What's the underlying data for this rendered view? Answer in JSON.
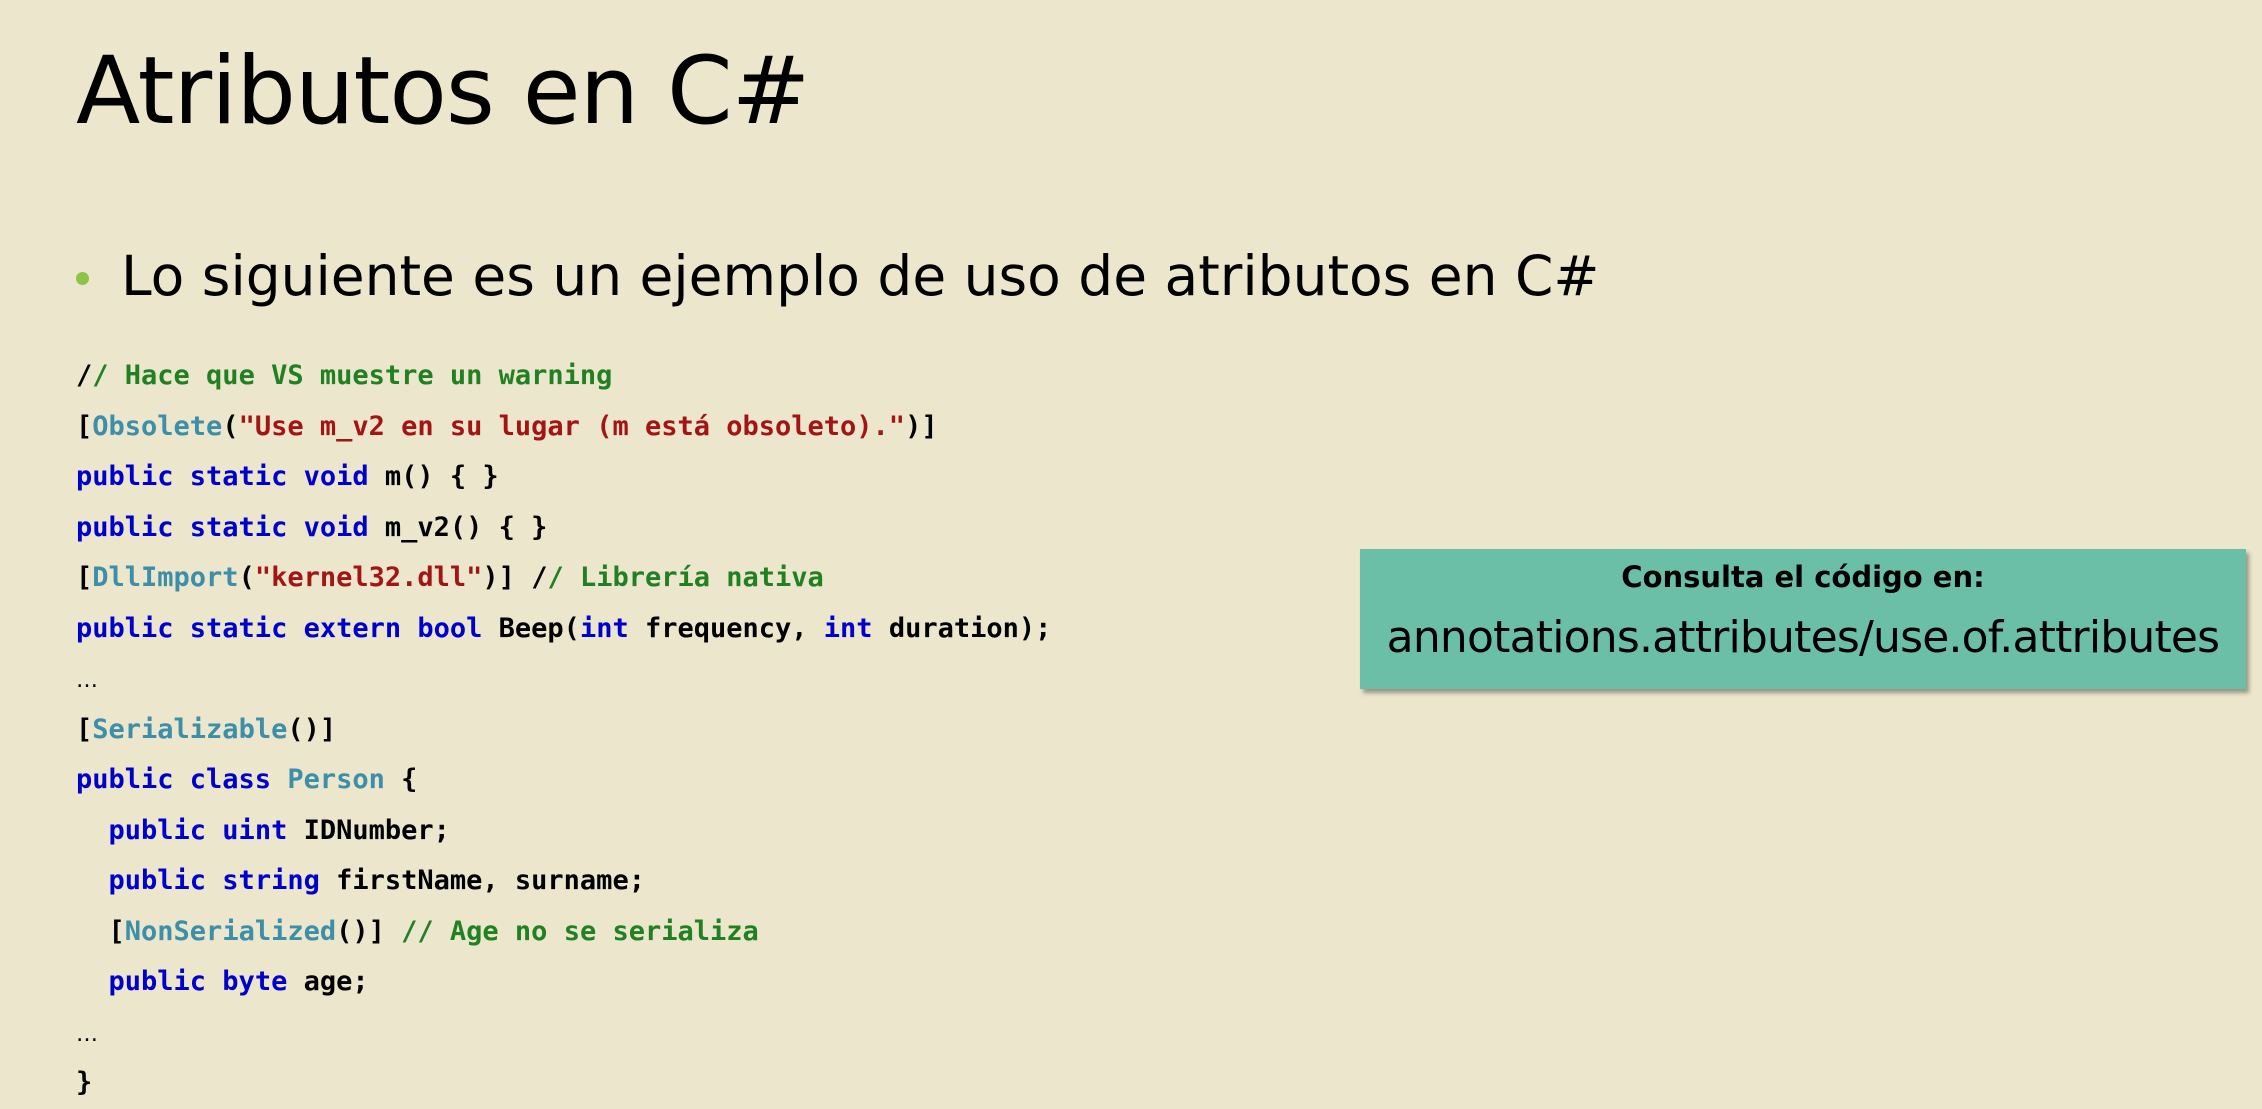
{
  "slide": {
    "title": "Atributos en C#",
    "bullet": "Lo siguiente es un ejemplo de uso de atributos en C#"
  },
  "code": {
    "lines": [
      [
        {
          "t": "/",
          "c": "pl"
        },
        {
          "t": "/ Hace que VS muestre un warning",
          "c": "cmt"
        }
      ],
      [
        {
          "t": "[",
          "c": "pl"
        },
        {
          "t": "Obsolete",
          "c": "typ"
        },
        {
          "t": "(",
          "c": "pl"
        },
        {
          "t": "\"Use m_v2 en su lugar (m está obsoleto).\"",
          "c": "str"
        },
        {
          "t": ")]",
          "c": "pl"
        }
      ],
      [
        {
          "t": "public static void",
          "c": "kw"
        },
        {
          "t": " m() { }",
          "c": "pl"
        }
      ],
      [
        {
          "t": "public static void",
          "c": "kw"
        },
        {
          "t": " m_v2() { }",
          "c": "pl"
        }
      ],
      [
        {
          "t": "[",
          "c": "pl"
        },
        {
          "t": "DllImport",
          "c": "typ"
        },
        {
          "t": "(",
          "c": "pl"
        },
        {
          "t": "\"kernel32.dll\"",
          "c": "str"
        },
        {
          "t": ")] /",
          "c": "pl"
        },
        {
          "t": "/ Librería nativa",
          "c": "cmt"
        }
      ],
      [
        {
          "t": "public static extern bool",
          "c": "kw"
        },
        {
          "t": " Beep(",
          "c": "pl"
        },
        {
          "t": "int",
          "c": "kw"
        },
        {
          "t": " frequency, ",
          "c": "pl"
        },
        {
          "t": "int",
          "c": "kw"
        },
        {
          "t": " duration);",
          "c": "pl"
        }
      ],
      [
        {
          "t": "…",
          "c": "pl dots"
        }
      ],
      [
        {
          "t": "[",
          "c": "pl"
        },
        {
          "t": "Serializable",
          "c": "typ"
        },
        {
          "t": "()]",
          "c": "pl"
        }
      ],
      [
        {
          "t": "public class",
          "c": "kw"
        },
        {
          "t": " ",
          "c": "pl"
        },
        {
          "t": "Person",
          "c": "typ"
        },
        {
          "t": " {",
          "c": "pl"
        }
      ],
      [
        {
          "t": "  ",
          "c": "pl"
        },
        {
          "t": "public uint",
          "c": "kw"
        },
        {
          "t": " IDNumber;",
          "c": "pl"
        }
      ],
      [
        {
          "t": "  ",
          "c": "pl"
        },
        {
          "t": "public string",
          "c": "kw"
        },
        {
          "t": " firstName, surname;",
          "c": "pl"
        }
      ],
      [
        {
          "t": "  [",
          "c": "pl"
        },
        {
          "t": "NonSerialized",
          "c": "typ"
        },
        {
          "t": "()] ",
          "c": "pl"
        },
        {
          "t": "// Age no se serializa",
          "c": "cmt"
        }
      ],
      [
        {
          "t": "  ",
          "c": "pl"
        },
        {
          "t": "public byte",
          "c": "kw"
        },
        {
          "t": " age;",
          "c": "pl"
        }
      ],
      [
        {
          "t": "…",
          "c": "pl dots"
        }
      ],
      [
        {
          "t": "}",
          "c": "pl"
        }
      ]
    ]
  },
  "callout": {
    "label": "Consulta el código en:",
    "path": "annotations.attributes/use.of.attributes"
  }
}
